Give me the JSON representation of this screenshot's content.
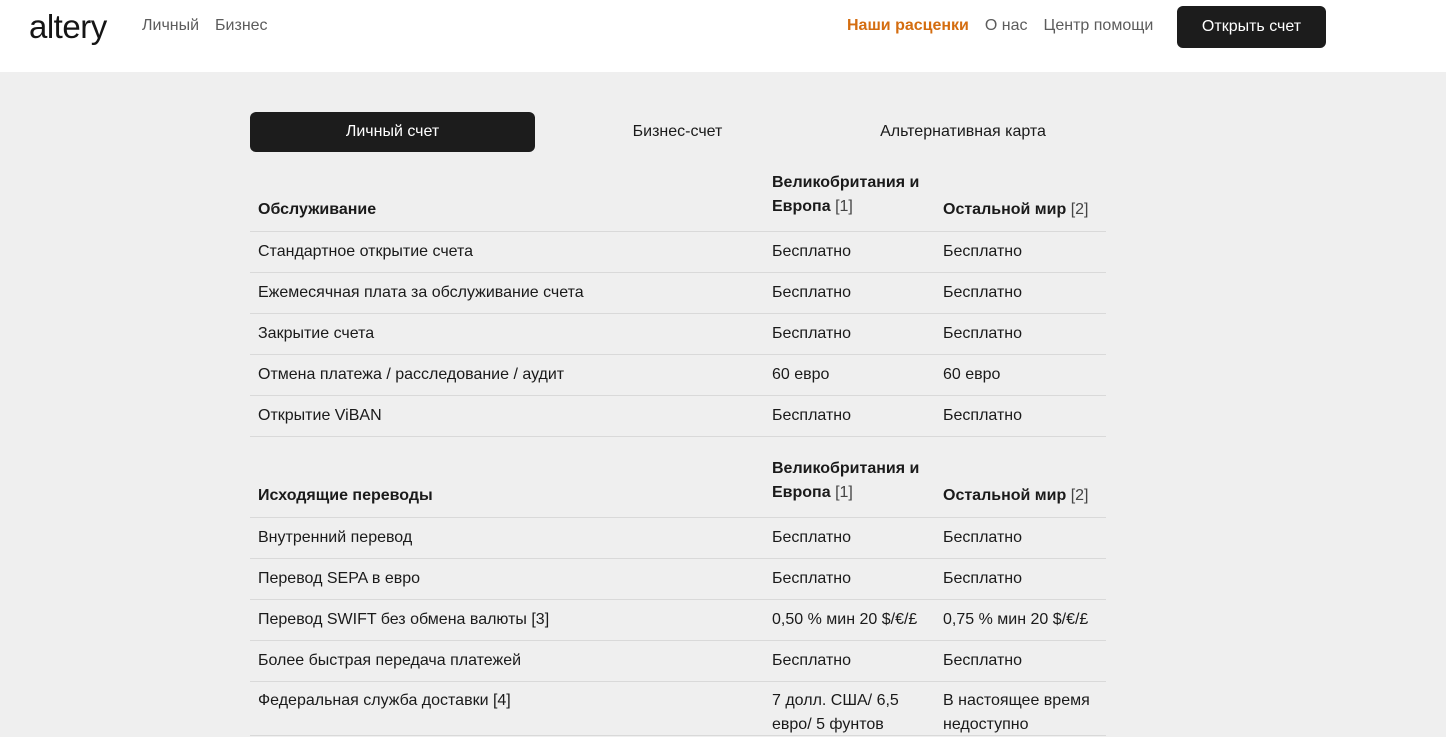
{
  "header": {
    "logo": "altery",
    "nav_left": [
      "Личный",
      "Бизнес"
    ],
    "nav_right": [
      "Наши расценки",
      "О нас",
      "Центр помощи"
    ],
    "cta": "Открыть счет",
    "accent_color": "#d46d10"
  },
  "tabs": [
    "Личный счет",
    "Бизнес-счет",
    "Альтернативная карта"
  ],
  "section1": {
    "title": "Обслуживание",
    "col2": "Великобритания и Европа",
    "col2_note": "[1]",
    "col3": "Остальной мир",
    "col3_note": "[2]",
    "rows": [
      {
        "name": "Стандартное открытие счета",
        "uk": "Бесплатно",
        "world": "Бесплатно"
      },
      {
        "name": "Ежемесячная плата за обслуживание счета",
        "uk": "Бесплатно",
        "world": "Бесплатно"
      },
      {
        "name": "Закрытие счета",
        "uk": "Бесплатно",
        "world": "Бесплатно"
      },
      {
        "name": "Отмена платежа / расследование / аудит",
        "uk": "60 евро",
        "world": "60 евро"
      },
      {
        "name": "Открытие ViBAN",
        "uk": "Бесплатно",
        "world": "Бесплатно"
      }
    ]
  },
  "section2": {
    "title": "Исходящие переводы",
    "col2": "Великобритания и Европа",
    "col2_note": "[1]",
    "col3": "Остальной мир",
    "col3_note": "[2]",
    "rows": [
      {
        "name": "Внутренний перевод",
        "uk": "Бесплатно",
        "world": "Бесплатно"
      },
      {
        "name": "Перевод SEPA в евро",
        "uk": "Бесплатно",
        "world": "Бесплатно"
      },
      {
        "name": "Перевод SWIFT без обмена валюты [3]",
        "uk": "0,50 % мин 20 $/€/£",
        "world": "0,75 % мин 20 $/€/£"
      },
      {
        "name": "Более быстрая передача платежей",
        "uk": "Бесплатно",
        "world": "Бесплатно"
      },
      {
        "name": "Федеральная служба доставки [4]",
        "uk": "7 долл. США/ 6,5 евро/ 5 фунтов",
        "world": "В настоящее время недоступно"
      }
    ]
  }
}
